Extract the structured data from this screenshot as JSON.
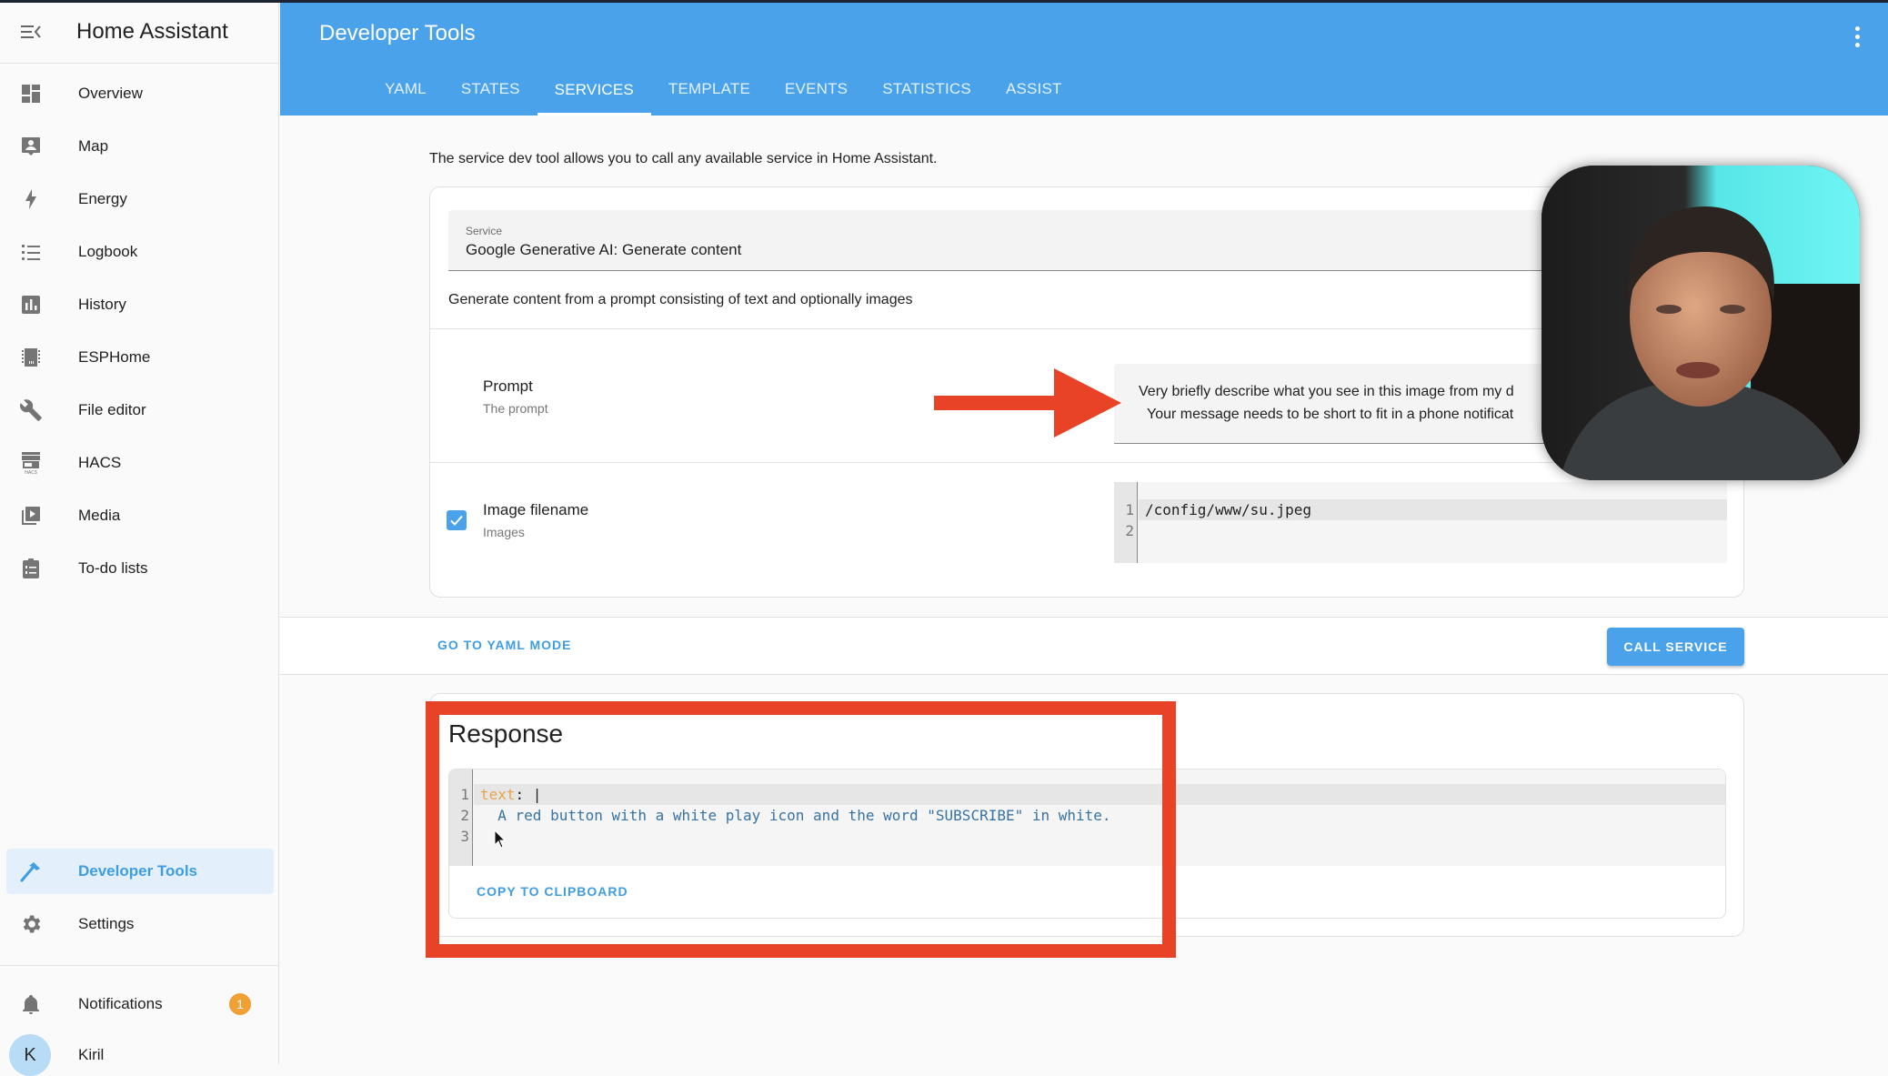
{
  "sidebar": {
    "title": "Home Assistant",
    "menu_icon": "menu-collapse-icon",
    "items": [
      {
        "label": "Overview",
        "icon": "dashboard-icon"
      },
      {
        "label": "Map",
        "icon": "map-person-icon"
      },
      {
        "label": "Energy",
        "icon": "lightning-bolt-icon"
      },
      {
        "label": "Logbook",
        "icon": "list-icon"
      },
      {
        "label": "History",
        "icon": "bar-chart-icon"
      },
      {
        "label": "ESPHome",
        "icon": "chip-icon"
      },
      {
        "label": "File editor",
        "icon": "wrench-icon"
      },
      {
        "label": "HACS",
        "icon": "hacs-store-icon"
      },
      {
        "label": "Media",
        "icon": "media-play-icon"
      },
      {
        "label": "To-do lists",
        "icon": "clipboard-list-icon"
      }
    ],
    "bottom_items": [
      {
        "label": "Developer Tools",
        "icon": "hammer-icon",
        "active": true
      },
      {
        "label": "Settings",
        "icon": "gear-icon"
      }
    ],
    "notifications": {
      "label": "Notifications",
      "count": "1"
    },
    "user": {
      "initial": "K",
      "name": "Kiril"
    }
  },
  "header": {
    "title": "Developer Tools",
    "tabs": [
      "YAML",
      "STATES",
      "SERVICES",
      "TEMPLATE",
      "EVENTS",
      "STATISTICS",
      "ASSIST"
    ],
    "active_tab": "SERVICES"
  },
  "main": {
    "intro": "The service dev tool allows you to call any available service in Home Assistant.",
    "service": {
      "label": "Service",
      "value": "Google Generative AI: Generate content",
      "description": "Generate content from a prompt consisting of text and optionally images"
    },
    "fields": {
      "prompt": {
        "name": "Prompt",
        "description": "The prompt",
        "value_lines": [
          "Very briefly describe what you see in this image from my d",
          "Your message needs to be short to fit in a phone notificat"
        ]
      },
      "image": {
        "name": "Image filename",
        "description": "Images",
        "checked": true,
        "code_lines": [
          "/config/www/su.jpeg",
          ""
        ]
      }
    },
    "actions": {
      "yaml_mode": "GO TO YAML MODE",
      "call_service": "CALL SERVICE"
    },
    "response": {
      "title": "Response",
      "code_key": "text",
      "code_sep": ": |",
      "code_value": "  A red button with a white play icon and the word \"SUBSCRIBE\" in white.",
      "line_numbers": [
        "1",
        "2",
        "3"
      ],
      "copy_button": "COPY TO CLIPBOARD"
    }
  },
  "colors": {
    "accent": "#4aa3ea",
    "highlight_red": "#e84327",
    "badge": "#f0a034"
  }
}
